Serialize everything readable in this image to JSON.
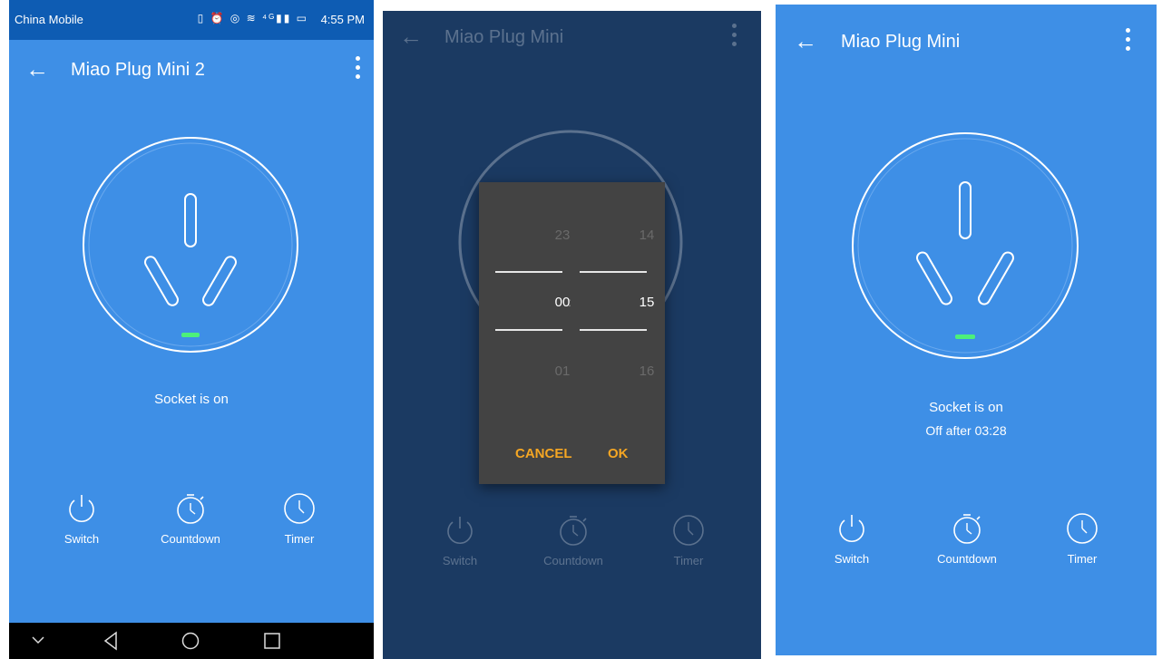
{
  "screen1": {
    "statusbar": {
      "carrier": "China Mobile",
      "icons": "▯ ⏰ ◎ ≋ ⁴ᴳ▮▮ ▭",
      "time": "4:55 PM"
    },
    "title": "Miao Plug Mini 2",
    "status_text": "Socket is on",
    "controls": [
      "Switch",
      "Countdown",
      "Timer"
    ],
    "navbar": [
      "back",
      "home",
      "recents"
    ]
  },
  "screen2": {
    "title": "Miao Plug Mini",
    "controls": [
      "Switch",
      "Countdown",
      "Timer"
    ],
    "picker": {
      "hours": {
        "prev": "23",
        "selected": "00",
        "next": "01"
      },
      "minutes": {
        "prev": "14",
        "selected": "15",
        "next": "16"
      },
      "separator": ":"
    },
    "cancel_label": "CANCEL",
    "ok_label": "OK"
  },
  "screen3": {
    "title": "Miao Plug Mini",
    "status_text": "Socket is on",
    "countdown_text": "Off after 03:28",
    "controls": [
      "Switch",
      "Countdown",
      "Timer"
    ]
  },
  "colors": {
    "app_blue": "#3e8fe6",
    "status_blue": "#0e5cb3",
    "dimmed_bg": "#1b3a62",
    "dialog_bg": "#434343",
    "accent_orange": "#f5a623",
    "indicator_green": "#4cf07a"
  }
}
